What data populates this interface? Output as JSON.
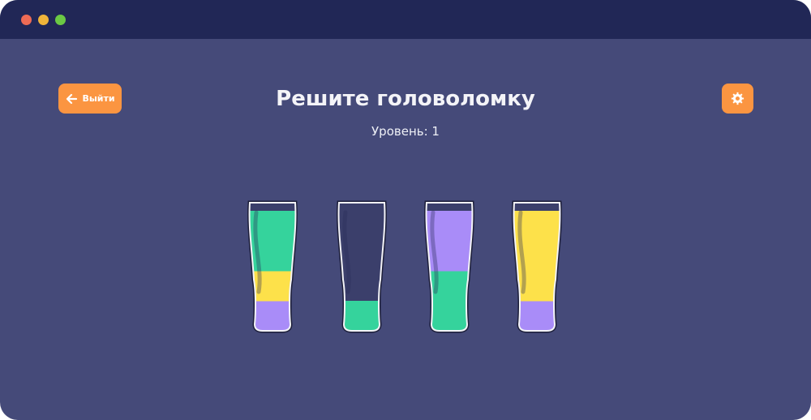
{
  "window": {
    "controls": [
      "close",
      "minimize",
      "maximize"
    ]
  },
  "header": {
    "back_label": "Выйти",
    "title": "Решите головоломку",
    "level_label": "Уровень: 1"
  },
  "icons": {
    "back": "arrow-left-icon",
    "settings": "gear-icon"
  },
  "colors": {
    "background": "#454a79",
    "titlebar": "#212756",
    "button": "#fb9541",
    "liquid_green": "#35d39c",
    "liquid_yellow": "#fde14a",
    "liquid_purple": "#a98cf8"
  },
  "game": {
    "capacity": 4,
    "glasses": [
      {
        "layers_bottom_to_top": [
          "purple",
          "yellow",
          "green",
          "green"
        ]
      },
      {
        "layers_bottom_to_top": [
          "green"
        ]
      },
      {
        "layers_bottom_to_top": [
          "green",
          "green",
          "purple",
          "purple"
        ]
      },
      {
        "layers_bottom_to_top": [
          "purple",
          "yellow",
          "yellow",
          "yellow"
        ]
      }
    ]
  }
}
